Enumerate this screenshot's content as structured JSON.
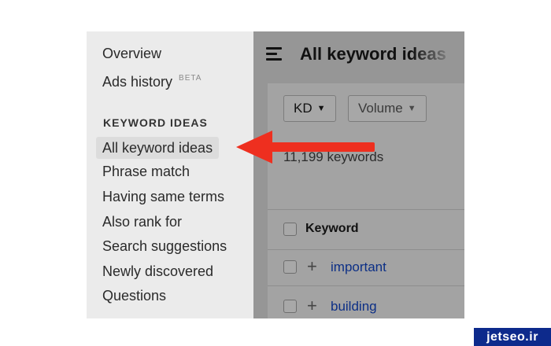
{
  "sidebar": {
    "overview_label": "Overview",
    "ads_history_label": "Ads history",
    "ads_history_badge": "BETA",
    "section_title": "KEYWORD IDEAS",
    "items": [
      {
        "label": "All keyword ideas",
        "active": true
      },
      {
        "label": "Phrase match"
      },
      {
        "label": "Having same terms"
      },
      {
        "label": "Also rank for"
      },
      {
        "label": "Search suggestions"
      },
      {
        "label": "Newly discovered"
      },
      {
        "label": "Questions"
      }
    ]
  },
  "main": {
    "title": "All keyword ideas",
    "filters": [
      {
        "label": "KD"
      },
      {
        "label": "Volume"
      }
    ],
    "keyword_count": "11,199 keywords",
    "table": {
      "column_header": "Keyword",
      "rows": [
        {
          "keyword": "important"
        },
        {
          "keyword": "building"
        }
      ]
    }
  },
  "watermark": "jetseo.ir",
  "colors": {
    "arrow": "#ee2f1f",
    "link": "#0c2f86",
    "watermark_bg": "#0d2a8c",
    "active_item_bg": "#dcdcdc"
  }
}
